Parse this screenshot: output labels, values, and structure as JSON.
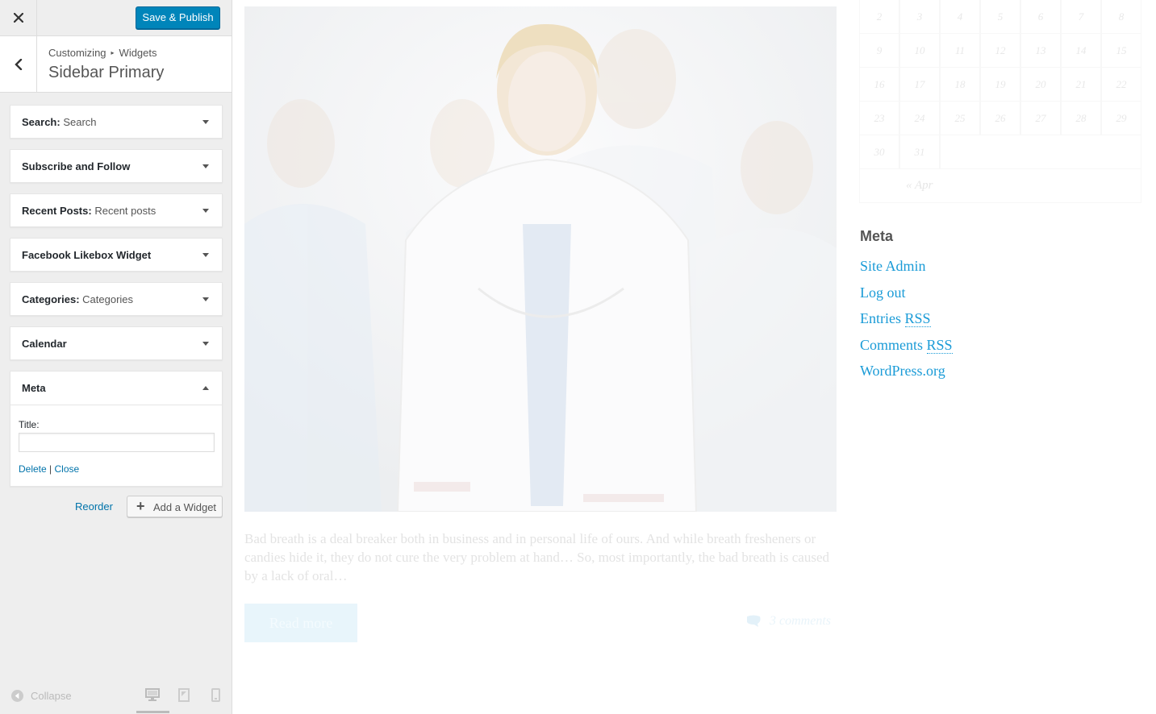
{
  "customizer": {
    "publish_label": "Save & Publish",
    "breadcrumb": {
      "root": "Customizing",
      "current": "Widgets"
    },
    "section_title": "Sidebar Primary",
    "widgets": [
      {
        "name": "Search",
        "sub": "Search"
      },
      {
        "name": "Subscribe and Follow",
        "sub": ""
      },
      {
        "name": "Recent Posts",
        "sub": "Recent posts"
      },
      {
        "name": "Facebook Likebox Widget",
        "sub": ""
      },
      {
        "name": "Categories",
        "sub": "Categories"
      },
      {
        "name": "Calendar",
        "sub": ""
      }
    ],
    "meta_widget": {
      "name": "Meta",
      "title_label": "Title:",
      "title_value": "",
      "delete_label": "Delete",
      "separator": "|",
      "close_label": "Close"
    },
    "reorder_label": "Reorder",
    "add_widget_label": "Add a Widget",
    "collapse_label": "Collapse"
  },
  "preview": {
    "excerpt": "Bad breath is a deal breaker both in business and in personal life of ours. And while breath fresheners or candies hide it, they do not cure the very problem at hand… So, most importantly, the bad breath is caused by a lack of oral…",
    "read_more_label": "Read more",
    "comments_label": "3 comments",
    "calendar": {
      "rows": [
        [
          "2",
          "3",
          "4",
          "5",
          "6",
          "7",
          "8"
        ],
        [
          "9",
          "10",
          "11",
          "12",
          "13",
          "14",
          "15"
        ],
        [
          "16",
          "17",
          "18",
          "19",
          "20",
          "21",
          "22"
        ],
        [
          "23",
          "24",
          "25",
          "26",
          "27",
          "28",
          "29"
        ],
        [
          "30",
          "31",
          "",
          "",
          "",
          "",
          ""
        ]
      ],
      "prev_label": "« Apr"
    },
    "meta": {
      "heading": "Meta",
      "links": [
        "Site Admin",
        "Log out",
        "Entries",
        "Comments",
        "WordPress.org"
      ],
      "rss_label": "RSS"
    }
  },
  "colors": {
    "accent": "#0085ba",
    "link": "#0073aa",
    "preview_link": "#1a9bd7"
  }
}
